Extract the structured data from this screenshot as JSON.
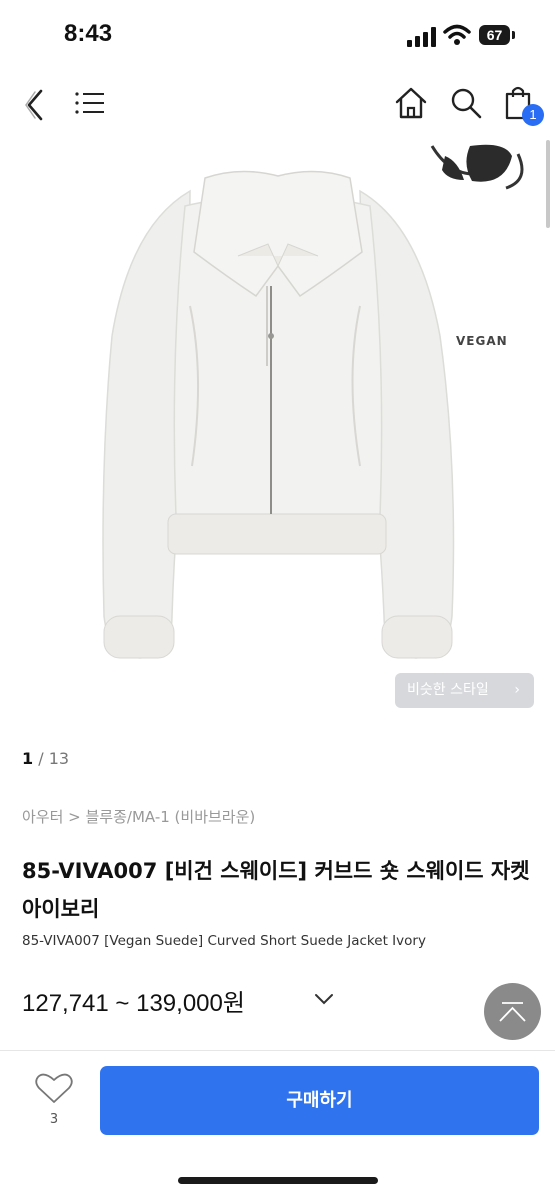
{
  "status_bar": {
    "time": "8:43",
    "battery": "67"
  },
  "nav": {
    "back_icon": "chevron-left-icon",
    "menu_icon": "hamburger-icon",
    "home_icon": "home-icon",
    "search_icon": "search-icon",
    "cart_icon": "shopping-bag-icon",
    "cart_count": "1"
  },
  "gallery": {
    "vegan_badge": "VEGAN",
    "similar_style_label": "비슷한 스타일",
    "current_page": "1",
    "separator": " / ",
    "total_pages": "13"
  },
  "product": {
    "breadcrumb": "아우터 > 블루종/MA-1 (비바브라운)",
    "title": "85-VIVA007 [비건 스웨이드] 커브드 숏 스웨이드 자켓 아이보리",
    "subtitle": "85-VIVA007 [Vegan Suede] Curved Short Suede Jacket Ivory",
    "price": "127,741 ~ 139,000원"
  },
  "actions": {
    "like_count": "3",
    "buy_label": "구매하기"
  },
  "colors": {
    "accent": "#2f74ee",
    "badge": "#2a6df5",
    "similar_button": "#d6d8dc",
    "scroll_top": "#8a8a8a"
  }
}
